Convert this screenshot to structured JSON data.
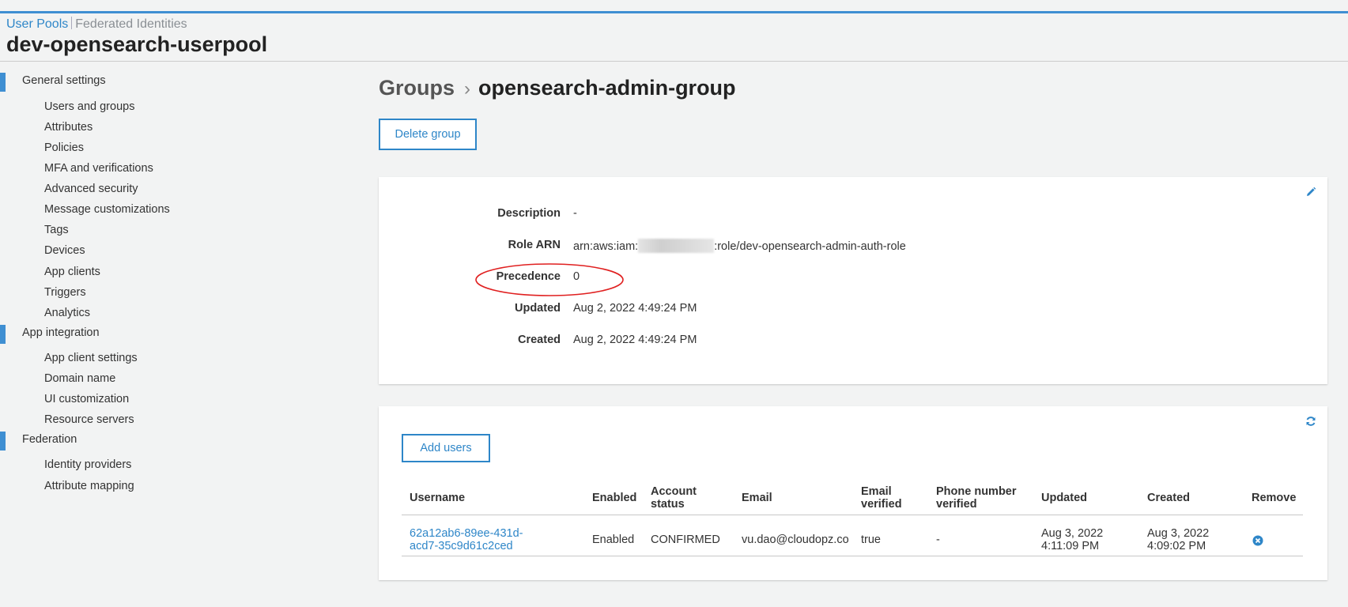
{
  "header": {
    "tab_user_pools": "User Pools",
    "tab_federated": "Federated Identities",
    "pool_name": "dev-opensearch-userpool"
  },
  "sidebar": {
    "general_settings": "General settings",
    "general_items": [
      "Users and groups",
      "Attributes",
      "Policies",
      "MFA and verifications",
      "Advanced security",
      "Message customizations",
      "Tags",
      "Devices",
      "App clients",
      "Triggers",
      "Analytics"
    ],
    "app_integration": "App integration",
    "app_items": [
      "App client settings",
      "Domain name",
      "UI customization",
      "Resource servers"
    ],
    "federation": "Federation",
    "federation_items": [
      "Identity providers",
      "Attribute mapping"
    ]
  },
  "breadcrumb": {
    "parent": "Groups",
    "separator": "›",
    "current": "opensearch-admin-group"
  },
  "actions": {
    "delete_group": "Delete group",
    "add_users": "Add users"
  },
  "details": {
    "description_label": "Description",
    "description_value": "-",
    "role_arn_label": "Role ARN",
    "role_arn_prefix": "arn:aws:iam:",
    "role_arn_suffix": ":role/dev-opensearch-admin-auth-role",
    "precedence_label": "Precedence",
    "precedence_value": "0",
    "updated_label": "Updated",
    "updated_value": "Aug 2, 2022 4:49:24 PM",
    "created_label": "Created",
    "created_value": "Aug 2, 2022 4:49:24 PM"
  },
  "users_table": {
    "headers": {
      "username": "Username",
      "enabled": "Enabled",
      "account_status_1": "Account",
      "account_status_2": "status",
      "email": "Email",
      "email_verified_1": "Email",
      "email_verified_2": "verified",
      "phone_verified_1": "Phone number",
      "phone_verified_2": "verified",
      "updated": "Updated",
      "created": "Created",
      "remove": "Remove"
    },
    "rows": [
      {
        "username_1": "62a12ab6-89ee-431d-",
        "username_2": "acd7-35c9d61c2ced",
        "enabled": "Enabled",
        "account_status": "CONFIRMED",
        "email": "vu.dao@cloudopz.co",
        "email_verified": "true",
        "phone_verified": "-",
        "updated_1": "Aug 3, 2022",
        "updated_2": "4:11:09 PM",
        "created_1": "Aug 3, 2022",
        "created_2": "4:09:02 PM"
      }
    ]
  },
  "colors": {
    "accent": "#2e86c8",
    "annotation": "#e02020"
  }
}
